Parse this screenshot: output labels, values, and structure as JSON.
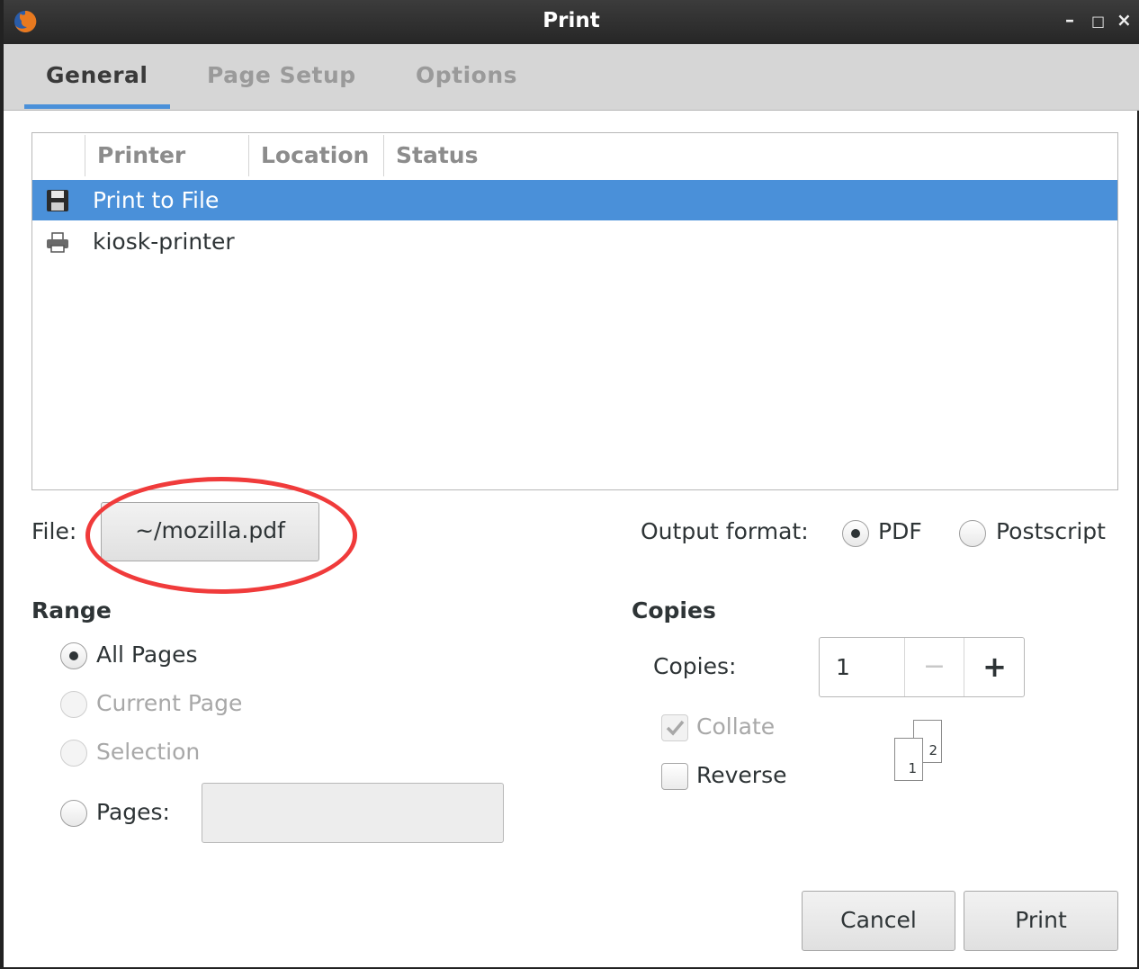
{
  "window": {
    "title": "Print"
  },
  "tabs": [
    {
      "label": "General"
    },
    {
      "label": "Page Setup"
    },
    {
      "label": "Options"
    }
  ],
  "printer_list": {
    "columns": [
      "Printer",
      "Location",
      "Status"
    ],
    "rows": [
      {
        "name": "Print to File",
        "icon": "floppy-disk-icon",
        "selected": true
      },
      {
        "name": "kiosk-printer",
        "icon": "printer-icon",
        "selected": false
      }
    ]
  },
  "file": {
    "label": "File:",
    "value": "~/mozilla.pdf"
  },
  "output_format": {
    "label": "Output format:",
    "options": [
      {
        "label": "PDF",
        "checked": true
      },
      {
        "label": "Postscript",
        "checked": false
      }
    ]
  },
  "range": {
    "heading": "Range",
    "options": [
      {
        "label": "All Pages",
        "checked": true,
        "enabled": true
      },
      {
        "label": "Current Page",
        "checked": false,
        "enabled": false
      },
      {
        "label": "Selection",
        "checked": false,
        "enabled": false
      },
      {
        "label": "Pages:",
        "checked": false,
        "enabled": true
      }
    ],
    "pages_value": ""
  },
  "copies": {
    "heading": "Copies",
    "label": "Copies:",
    "value": "1",
    "minus": "−",
    "plus": "+",
    "collate": {
      "label": "Collate",
      "checked": true,
      "enabled": false
    },
    "reverse": {
      "label": "Reverse",
      "checked": false,
      "enabled": true
    },
    "preview_pages": [
      "1",
      "2"
    ]
  },
  "buttons": {
    "cancel": "Cancel",
    "print": "Print"
  },
  "colors": {
    "accent": "#4a90d9",
    "annotation": "#f03b3b",
    "titlebar": "#2b2b2b"
  }
}
